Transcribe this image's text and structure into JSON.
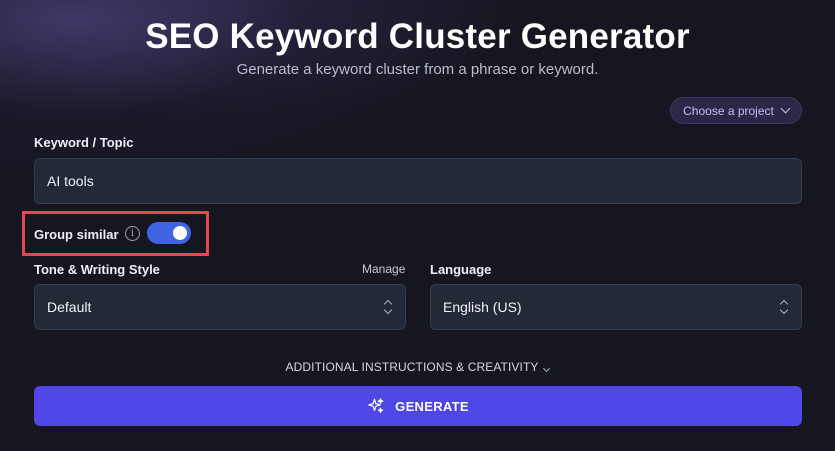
{
  "header": {
    "title": "SEO Keyword Cluster Generator",
    "subtitle": "Generate a keyword cluster from a phrase or keyword."
  },
  "project_selector": {
    "label": "Choose a project",
    "icon": "chevron-down-icon"
  },
  "keyword": {
    "label": "Keyword / Topic",
    "value": "AI tools"
  },
  "group_similar": {
    "label": "Group similar",
    "enabled": true,
    "info_icon": "info-icon"
  },
  "tone": {
    "label": "Tone & Writing Style",
    "manage_label": "Manage",
    "value": "Default"
  },
  "language": {
    "label": "Language",
    "value": "English (US)"
  },
  "additional": {
    "label": "ADDITIONAL INSTRUCTIONS & CREATIVITY"
  },
  "generate": {
    "label": "GENERATE",
    "icon": "sparkles-icon"
  },
  "colors": {
    "background": "#161620",
    "accent": "#4e46e5",
    "toggle_on": "#3f63e3",
    "highlight_box": "#e8474f"
  }
}
